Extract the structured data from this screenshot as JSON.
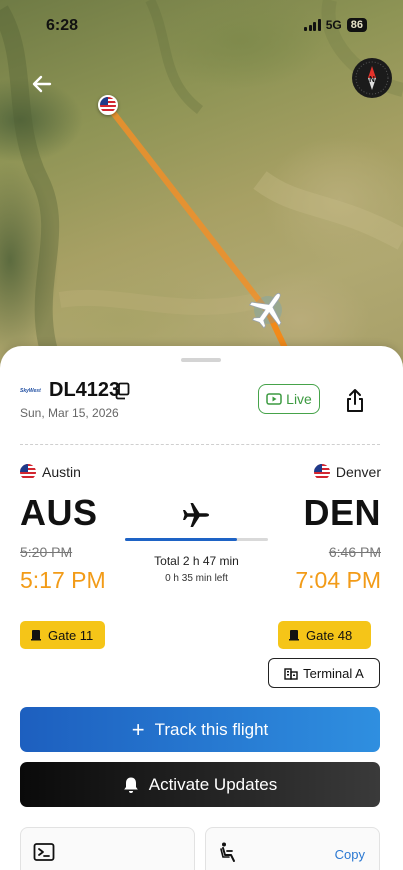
{
  "status_bar": {
    "time": "6:28",
    "network": "5G",
    "battery": "86"
  },
  "map": {
    "route_color": "#f0902a",
    "origin_marker_icon": "us-flag-icon",
    "plane_marker_icon": "airplane-icon",
    "compass_label": "N"
  },
  "flight": {
    "airline_logo_text": "SkyWest",
    "number": "DL4123",
    "date": "Sun, Mar 15, 2026",
    "live_label": "Live",
    "departure": {
      "city": "Austin",
      "code": "AUS",
      "scheduled": "5:20 PM",
      "actual": "5:17 PM",
      "gate": "Gate 11"
    },
    "arrival": {
      "city": "Denver",
      "code": "DEN",
      "scheduled": "6:46 PM",
      "actual": "7:04 PM",
      "gate": "Gate 48",
      "terminal": "Terminal A"
    },
    "total_duration": "Total 2 h 47 min",
    "time_left": "0 h 35 min left",
    "progress_fraction": 0.78
  },
  "actions": {
    "track_label": "Track this flight",
    "updates_label": "Activate Updates"
  },
  "cards": {
    "copy_label": "Copy"
  },
  "colors": {
    "accent_orange": "#f29b17",
    "gate_yellow": "#f5c518",
    "live_green": "#46a34a",
    "track_blue": "#1d5fbf"
  }
}
